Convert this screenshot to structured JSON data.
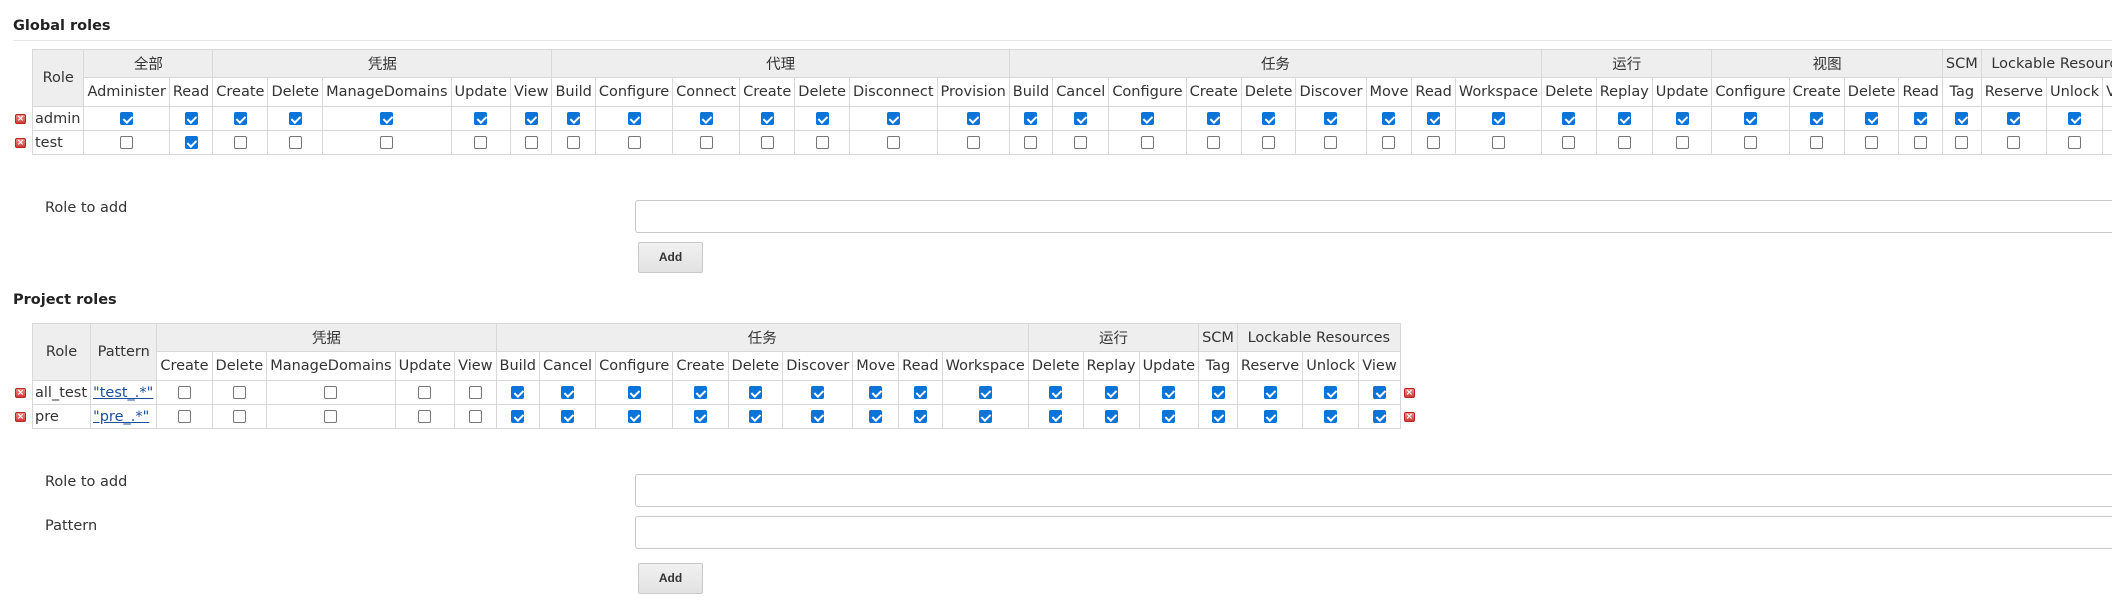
{
  "global": {
    "title": "Global roles",
    "role_header": "Role",
    "groups": [
      {
        "label": "全部",
        "cols": [
          "Administer",
          "Read"
        ]
      },
      {
        "label": "凭据",
        "cols": [
          "Create",
          "Delete",
          "ManageDomains",
          "Update",
          "View"
        ]
      },
      {
        "label": "代理",
        "cols": [
          "Build",
          "Configure",
          "Connect",
          "Create",
          "Delete",
          "Disconnect",
          "Provision"
        ]
      },
      {
        "label": "任务",
        "cols": [
          "Build",
          "Cancel",
          "Configure",
          "Create",
          "Delete",
          "Discover",
          "Move",
          "Read",
          "Workspace"
        ]
      },
      {
        "label": "运行",
        "cols": [
          "Delete",
          "Replay",
          "Update"
        ]
      },
      {
        "label": "视图",
        "cols": [
          "Configure",
          "Create",
          "Delete",
          "Read"
        ]
      },
      {
        "label": "SCM",
        "cols": [
          "Tag"
        ]
      },
      {
        "label": "Lockable Resources",
        "cols": [
          "Reserve",
          "Unlock",
          "View"
        ]
      }
    ],
    "rows": [
      {
        "name": "admin",
        "checks": [
          1,
          1,
          1,
          1,
          1,
          1,
          1,
          1,
          1,
          1,
          1,
          1,
          1,
          1,
          1,
          1,
          1,
          1,
          1,
          1,
          1,
          1,
          1,
          1,
          1,
          1,
          1,
          1,
          1,
          1,
          1,
          1,
          1,
          1
        ]
      },
      {
        "name": "test",
        "checks": [
          0,
          1,
          0,
          0,
          0,
          0,
          0,
          0,
          0,
          0,
          0,
          0,
          0,
          0,
          0,
          0,
          0,
          0,
          0,
          0,
          0,
          0,
          0,
          0,
          0,
          0,
          0,
          0,
          0,
          0,
          0,
          0,
          0,
          0
        ]
      }
    ],
    "role_to_add_label": "Role to add",
    "add_button": "Add"
  },
  "project": {
    "title": "Project roles",
    "role_header": "Role",
    "pattern_header": "Pattern",
    "groups": [
      {
        "label": "凭据",
        "cols": [
          "Create",
          "Delete",
          "ManageDomains",
          "Update",
          "View"
        ]
      },
      {
        "label": "任务",
        "cols": [
          "Build",
          "Cancel",
          "Configure",
          "Create",
          "Delete",
          "Discover",
          "Move",
          "Read",
          "Workspace"
        ]
      },
      {
        "label": "运行",
        "cols": [
          "Delete",
          "Replay",
          "Update"
        ]
      },
      {
        "label": "SCM",
        "cols": [
          "Tag"
        ]
      },
      {
        "label": "Lockable Resources",
        "cols": [
          "Reserve",
          "Unlock",
          "View"
        ]
      }
    ],
    "rows": [
      {
        "name": "all_test",
        "pattern": "\"test_.*\"",
        "checks": [
          0,
          0,
          0,
          0,
          0,
          1,
          1,
          1,
          1,
          1,
          1,
          1,
          1,
          1,
          1,
          1,
          1,
          1,
          1,
          1,
          1
        ]
      },
      {
        "name": "pre",
        "pattern": "\"pre_.*\"",
        "checks": [
          0,
          0,
          0,
          0,
          0,
          1,
          1,
          1,
          1,
          1,
          1,
          1,
          1,
          1,
          1,
          1,
          1,
          1,
          1,
          1,
          1
        ]
      }
    ],
    "role_to_add_label": "Role to add",
    "pattern_label": "Pattern",
    "add_button": "Add"
  },
  "colors": {
    "checkbox": "#0a74d9",
    "delete_icon": "#d43a3a",
    "link": "#1a4f9c",
    "header_bg": "#eeeeee"
  }
}
